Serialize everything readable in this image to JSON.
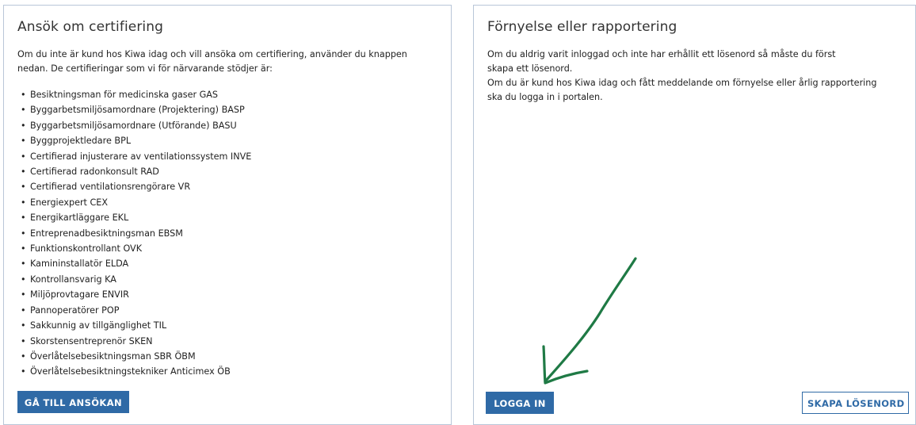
{
  "left_panel": {
    "title": "Ansök om certifiering",
    "intro_line1": "Om du inte är kund hos Kiwa idag och vill ansöka om certifiering, använder du knappen",
    "intro_line2": "nedan. De certifieringar som vi för närvarande stödjer är:",
    "bullet": "•",
    "certifications": [
      "Besiktningsman för medicinska gaser GAS",
      "Byggarbetsmiljösamordnare (Projektering) BASP",
      "Byggarbetsmiljösamordnare (Utförande) BASU",
      "Byggprojektledare BPL",
      "Certifierad injusterare av ventilationssystem INVE",
      "Certifierad radonkonsult RAD",
      "Certifierad ventilationsrengörare VR",
      "Energiexpert CEX",
      "Energikartläggare EKL",
      "Entreprenadbesiktningsman EBSM",
      "Funktionskontrollant OVK",
      "Kamininstallatör ELDA",
      "Kontrollansvarig KA",
      "Miljöprovtagare ENVIR",
      "Pannoperatörer POP",
      "Sakkunnig av tillgänglighet TIL",
      "Skorstensentreprenör SKEN",
      "Överlåtelsebesiktningsman SBR ÖBM",
      "Överlåtelsebesiktningstekniker Anticimex ÖB"
    ],
    "apply_button": "GÅ TILL ANSÖKAN"
  },
  "right_panel": {
    "title": "Förnyelse eller rapportering",
    "intro_line1": "Om du aldrig varit inloggad och inte har erhållit ett lösenord så måste du först",
    "intro_line2": "skapa ett lösenord.",
    "intro_line3": "Om du är kund hos Kiwa idag och fått meddelande om förnyelse eller årlig rapportering",
    "intro_line4": "ska du logga in i portalen.",
    "login_button": "LOGGA IN",
    "create_password_button": "SKAPA LÖSENORD"
  },
  "colors": {
    "primary_button": "#2f6aa6",
    "panel_border": "#b9c6d8",
    "annotation_arrow": "#1f7a45"
  },
  "annotation": {
    "icon": "hand-drawn-green-arrow-icon"
  }
}
